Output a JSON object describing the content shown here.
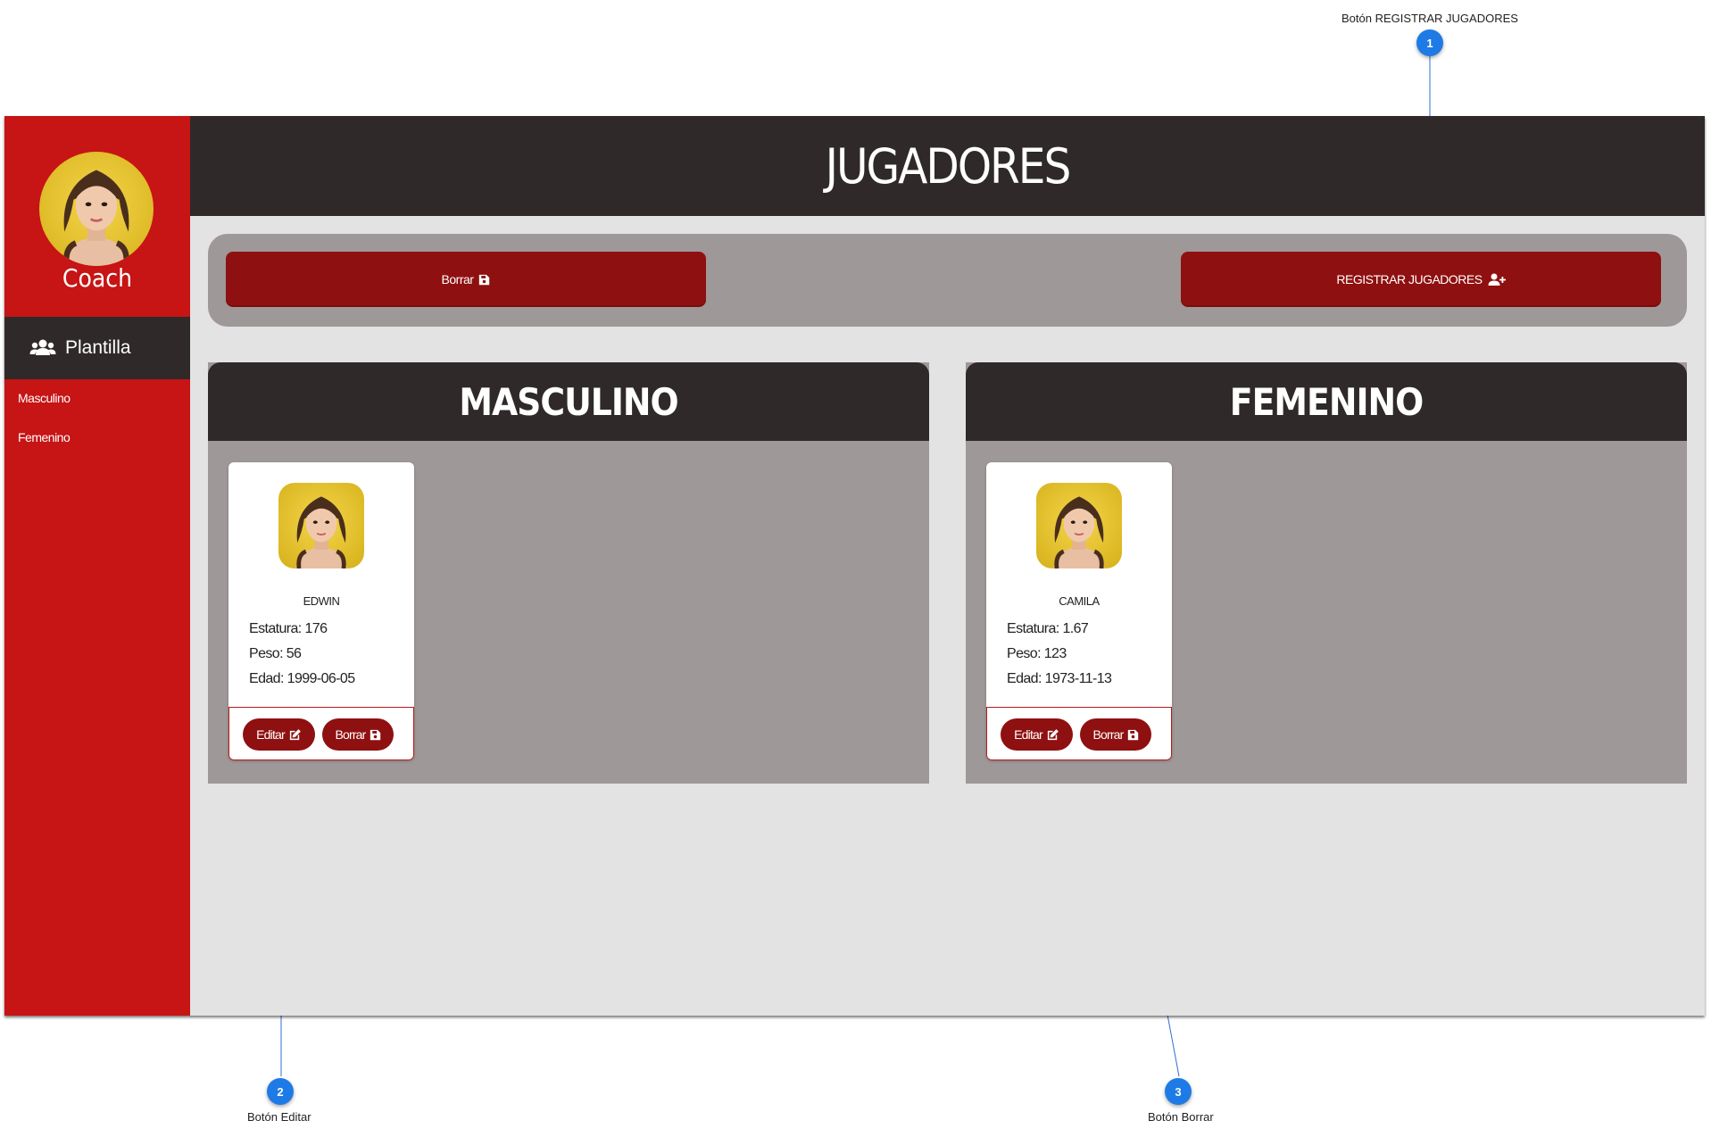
{
  "callouts": [
    {
      "number": "1",
      "label": "Botón REGISTRAR JUGADORES"
    },
    {
      "number": "2",
      "label": "Botón Editar"
    },
    {
      "number": "3",
      "label": "Botón Borrar"
    }
  ],
  "sidebar": {
    "user_name": "Coach",
    "nav_main_label": "Plantilla",
    "nav_main_icon": "users-icon",
    "items": [
      {
        "label": "Masculino"
      },
      {
        "label": "Femenino"
      }
    ]
  },
  "header": {
    "title": "JUGADORES"
  },
  "toolbar": {
    "delete_label": "Borrar",
    "delete_icon": "save-icon",
    "register_label": "REGISTRAR JUGADORES",
    "register_icon": "user-plus-icon"
  },
  "panels": [
    {
      "title": "MASCULINO",
      "cards": [
        {
          "name": "EDWIN",
          "height_line": "Estatura: 176",
          "weight_line": "Peso: 56",
          "age_line": "Edad: 1999-06-05",
          "edit_label": "Editar",
          "delete_label": "Borrar"
        }
      ]
    },
    {
      "title": "FEMENINO",
      "cards": [
        {
          "name": "CAMILA",
          "height_line": "Estatura: 1.67",
          "weight_line": "Peso: 123",
          "age_line": "Edad: 1973-11-13",
          "edit_label": "Editar",
          "delete_label": "Borrar"
        }
      ]
    }
  ],
  "colors": {
    "sidebar": "#c71414",
    "dark": "#2f2a29",
    "button": "#8f1010",
    "panel": "#9e9898",
    "background": "#e4e3e3",
    "callout": "#1e7be6"
  }
}
